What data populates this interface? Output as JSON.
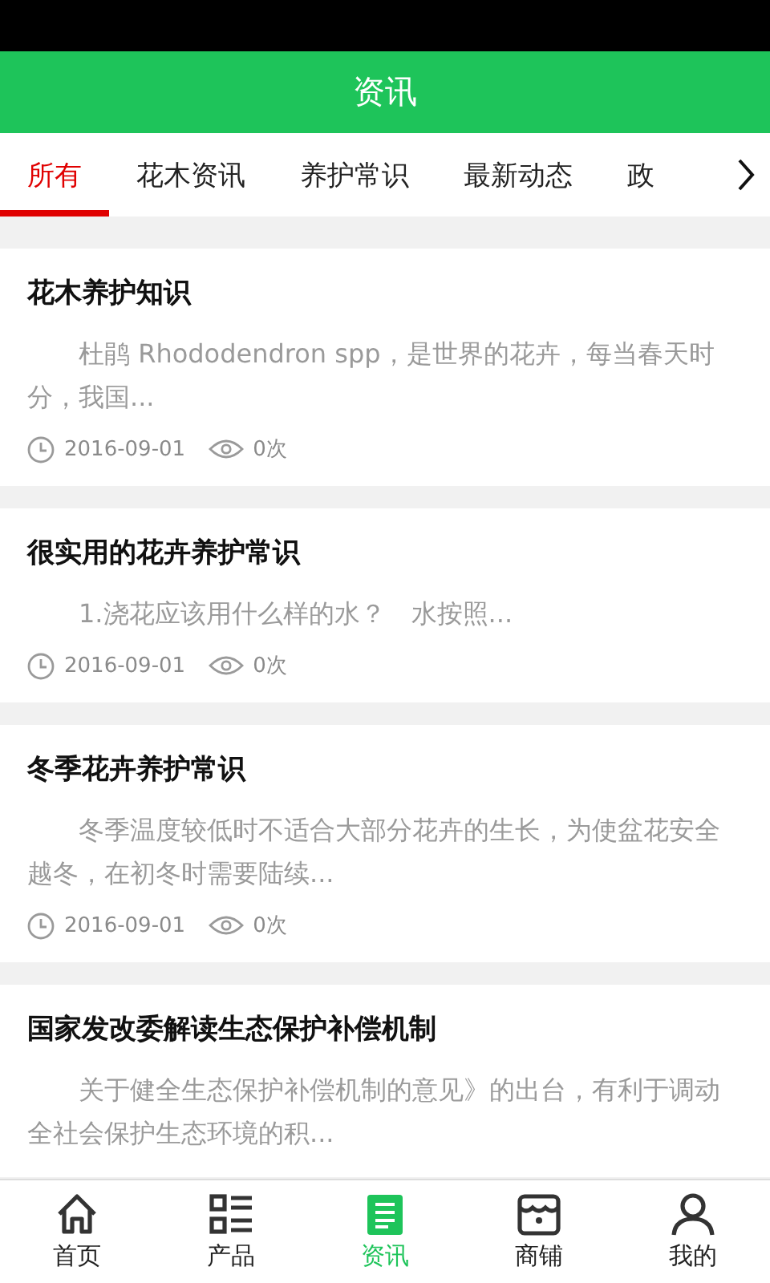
{
  "header": {
    "title": "资讯"
  },
  "tabs": [
    {
      "label": "所有",
      "selected": true
    },
    {
      "label": "花木资讯",
      "selected": false
    },
    {
      "label": "养护常识",
      "selected": false
    },
    {
      "label": "最新动态",
      "selected": false
    },
    {
      "label": "政",
      "selected": false
    }
  ],
  "articles": [
    {
      "title": "花木养护知识",
      "summary": "杜鹃 Rhododendron spp，是世界的花卉，每当春天时分，我国...",
      "date": "2016-09-01",
      "views": "0次"
    },
    {
      "title": "很实用的花卉养护常识",
      "summary": "1.浇花应该用什么样的水？　水按照...",
      "date": "2016-09-01",
      "views": "0次"
    },
    {
      "title": "冬季花卉养护常识",
      "summary": "冬季温度较低时不适合大部分花卉的生长，为使盆花安全越冬，在初冬时需要陆续...",
      "date": "2016-09-01",
      "views": "0次"
    },
    {
      "title": "国家发改委解读生态保护补偿机制",
      "summary": "关于健全生态保护补偿机制的意见》的出台，有利于调动全社会保护生态环境的积..."
    }
  ],
  "bottom_nav": [
    {
      "kind": "home",
      "label": "首页",
      "selected": false
    },
    {
      "kind": "products",
      "label": "产品",
      "selected": false
    },
    {
      "kind": "news",
      "label": "资讯",
      "selected": true
    },
    {
      "kind": "shop",
      "label": "商铺",
      "selected": false
    },
    {
      "kind": "profile",
      "label": "我的",
      "selected": false
    }
  ]
}
